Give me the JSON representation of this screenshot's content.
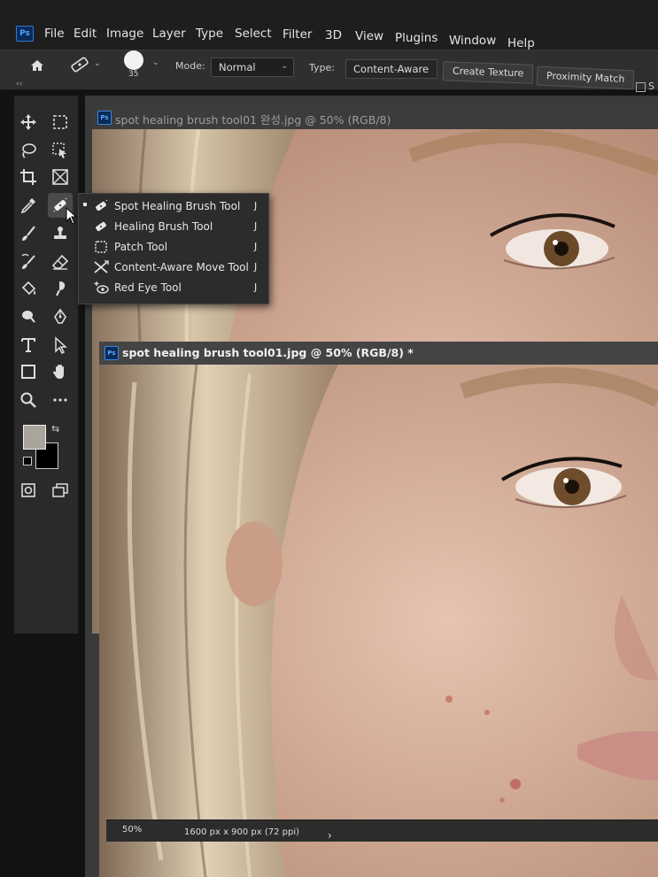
{
  "app": {
    "logo": "Ps"
  },
  "menu": [
    "File",
    "Edit",
    "Image",
    "Layer",
    "Type",
    "Select",
    "Filter",
    "3D",
    "View",
    "Plugins",
    "Window",
    "Help"
  ],
  "options": {
    "brush_size": "35",
    "mode_label": "Mode:",
    "mode_value": "Normal",
    "type_label": "Type:",
    "type_options": [
      "Content-Aware",
      "Create Texture",
      "Proximity Match"
    ],
    "sample_partial": "S"
  },
  "panel_collapse": "‹‹",
  "documents": [
    {
      "title": "spot healing brush tool01 완성.jpg @ 50% (RGB/8)"
    },
    {
      "title": "spot healing brush tool01.jpg @ 50% (RGB/8) *"
    }
  ],
  "flyout": {
    "items": [
      {
        "label": "Spot Healing Brush Tool",
        "shortcut": "J",
        "icon": "spot-healing-brush-icon",
        "active": true
      },
      {
        "label": "Healing Brush Tool",
        "shortcut": "J",
        "icon": "healing-brush-icon",
        "active": false
      },
      {
        "label": "Patch Tool",
        "shortcut": "J",
        "icon": "patch-icon",
        "active": false
      },
      {
        "label": "Content-Aware Move Tool",
        "shortcut": "J",
        "icon": "content-aware-move-icon",
        "active": false
      },
      {
        "label": "Red Eye Tool",
        "shortcut": "J",
        "icon": "red-eye-icon",
        "active": false
      }
    ]
  },
  "status": {
    "zoom": "50%",
    "doc_size": "1600 px x 900 px (72 ppi)",
    "arrow": "›"
  },
  "colors": {
    "foreground": "#a9a49c",
    "background": "#000000",
    "accent": "#2f79d6"
  }
}
